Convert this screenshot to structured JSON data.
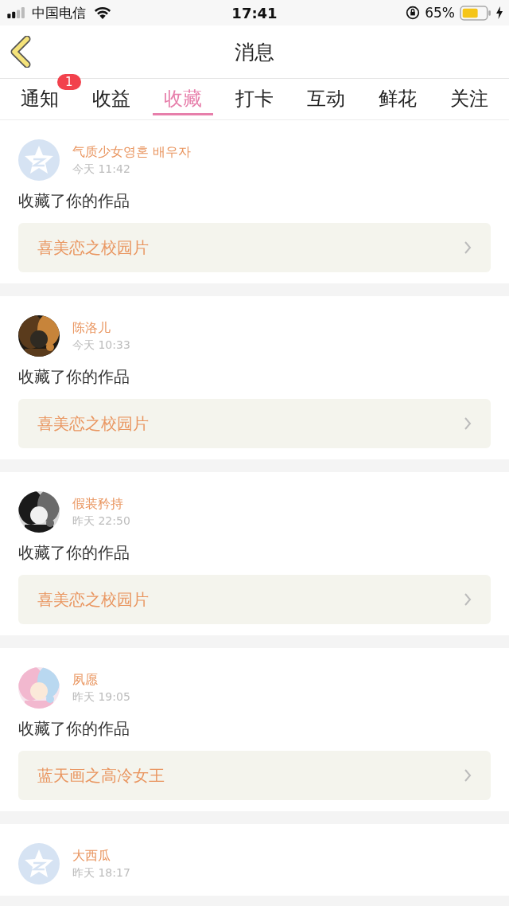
{
  "status_bar": {
    "carrier": "中国电信",
    "time": "17:41",
    "battery": "65%"
  },
  "header": {
    "title": "消息"
  },
  "tabs": [
    {
      "label": "通知",
      "selected": false,
      "badge": "1"
    },
    {
      "label": "收益",
      "selected": false
    },
    {
      "label": "收藏",
      "selected": true
    },
    {
      "label": "打卡",
      "selected": false
    },
    {
      "label": "互动",
      "selected": false
    },
    {
      "label": "鲜花",
      "selected": false
    },
    {
      "label": "关注",
      "selected": false
    }
  ],
  "messages": [
    {
      "kind": "default",
      "name": "气质少女영혼 배우자",
      "time": "今天 11:42",
      "text": "收藏了你的作品",
      "work": "喜美恋之校园片"
    },
    {
      "kind": "picture",
      "name": "陈洛儿",
      "time": "今天 10:33",
      "text": "收藏了你的作品",
      "work": "喜美恋之校园片"
    },
    {
      "kind": "picture",
      "name": "假装矜持",
      "time": "昨天 22:50",
      "text": "收藏了你的作品",
      "work": "喜美恋之校园片"
    },
    {
      "kind": "picture",
      "name": "夙愿",
      "time": "昨天 19:05",
      "text": "收藏了你的作品",
      "work": "蓝天画之高冷女王"
    },
    {
      "kind": "default",
      "name": "大西瓜",
      "time": "昨天 18:17"
    }
  ]
}
